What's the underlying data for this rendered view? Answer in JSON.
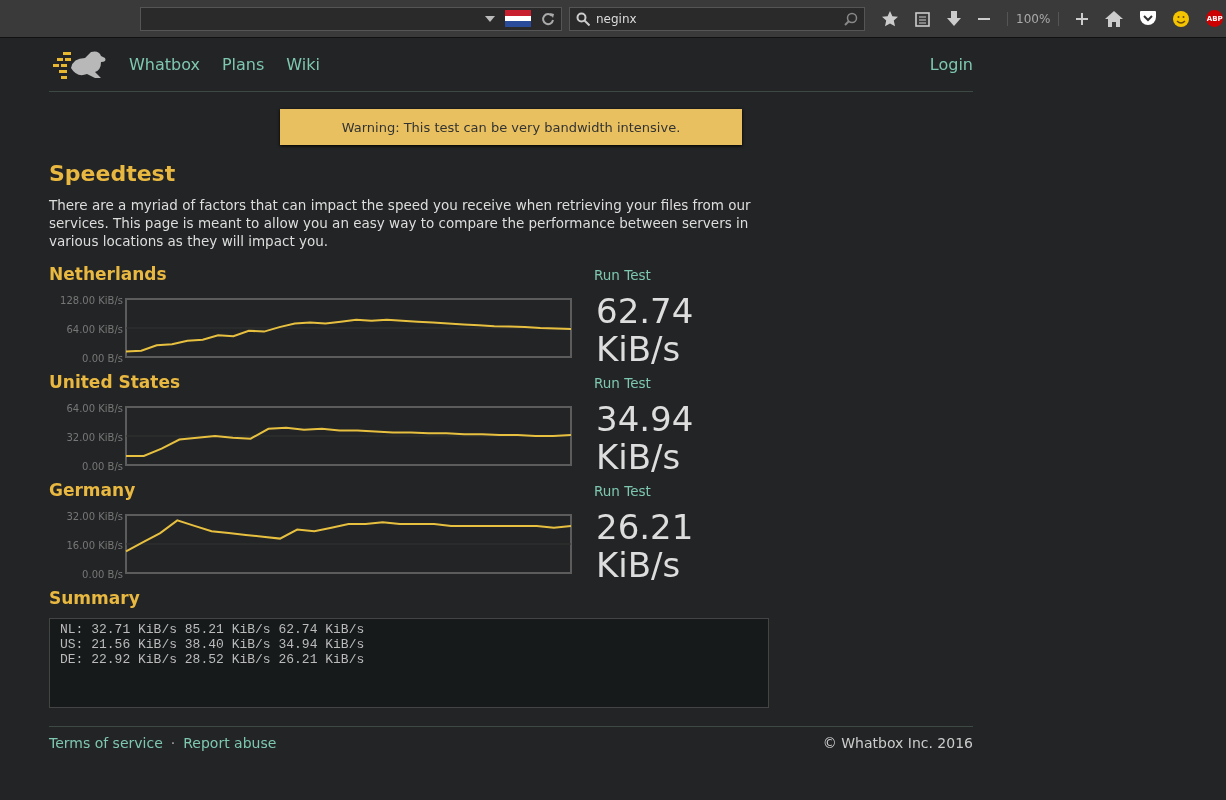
{
  "browser": {
    "search": {
      "value": "neginx"
    },
    "zoom": "100%",
    "adblock_badge": "ABP"
  },
  "nav": {
    "links": [
      "Whatbox",
      "Plans",
      "Wiki"
    ],
    "login": "Login"
  },
  "warning": "Warning: This test can be very bandwidth intensive.",
  "title": "Speedtest",
  "intro": "There are a myriad of factors that can impact the speed you receive when retrieving your files from our services. This page is meant to allow you an easy way to compare the performance between servers in various locations as they will impact you.",
  "tests": [
    {
      "name": "Netherlands",
      "action": "Run Test",
      "speed": "62.74 KiB/s",
      "chart_data": {
        "type": "line",
        "ylim": [
          0,
          128
        ],
        "yticks": [
          {
            "value": 128,
            "label": "128.00 KiB/s"
          },
          {
            "value": 64,
            "label": "64.00 KiB/s"
          },
          {
            "value": 0,
            "label": "0.00 B/s"
          }
        ],
        "series": [
          {
            "color": "#e8c040",
            "values": [
              12,
              14,
              26,
              28,
              36,
              38,
              48,
              46,
              58,
              56,
              66,
              74,
              76,
              74,
              78,
              82,
              80,
              82,
              80,
              78,
              76,
              74,
              72,
              70,
              68,
              67,
              66,
              64,
              63,
              62
            ]
          }
        ]
      }
    },
    {
      "name": "United States",
      "action": "Run Test",
      "speed": "34.94 KiB/s",
      "chart_data": {
        "type": "line",
        "ylim": [
          0,
          64
        ],
        "yticks": [
          {
            "value": 64,
            "label": "64.00 KiB/s"
          },
          {
            "value": 32,
            "label": "32.00 KiB/s"
          },
          {
            "value": 0,
            "label": "0.00 B/s"
          }
        ],
        "series": [
          {
            "color": "#e8c040",
            "values": [
              10,
              10,
              18,
              28,
              30,
              32,
              30,
              29,
              40,
              41,
              39,
              40,
              38,
              38,
              37,
              36,
              36,
              35,
              35,
              34,
              34,
              33,
              33,
              32,
              32,
              33
            ]
          }
        ]
      }
    },
    {
      "name": "Germany",
      "action": "Run Test",
      "speed": "26.21 KiB/s",
      "chart_data": {
        "type": "line",
        "ylim": [
          0,
          32
        ],
        "yticks": [
          {
            "value": 32,
            "label": "32.00 KiB/s"
          },
          {
            "value": 16,
            "label": "16.00 KiB/s"
          },
          {
            "value": 0,
            "label": "0.00 B/s"
          }
        ],
        "series": [
          {
            "color": "#e8c040",
            "values": [
              12,
              17,
              22,
              29,
              26,
              23,
              22,
              21,
              20,
              19,
              24,
              23,
              25,
              27,
              27,
              28,
              27,
              27,
              27,
              26,
              26,
              26,
              26,
              26,
              26,
              25,
              26
            ]
          }
        ]
      }
    }
  ],
  "summary": {
    "title": "Summary",
    "lines": [
      "NL: 32.71 KiB/s 85.21 KiB/s 62.74 KiB/s",
      "US: 21.56 KiB/s 38.40 KiB/s 34.94 KiB/s",
      "DE: 22.92 KiB/s 28.52 KiB/s 26.21 KiB/s"
    ]
  },
  "footer": {
    "links": [
      "Terms of service",
      "Report abuse"
    ],
    "separator": "·",
    "copyright": "© Whatbox Inc. 2016"
  }
}
